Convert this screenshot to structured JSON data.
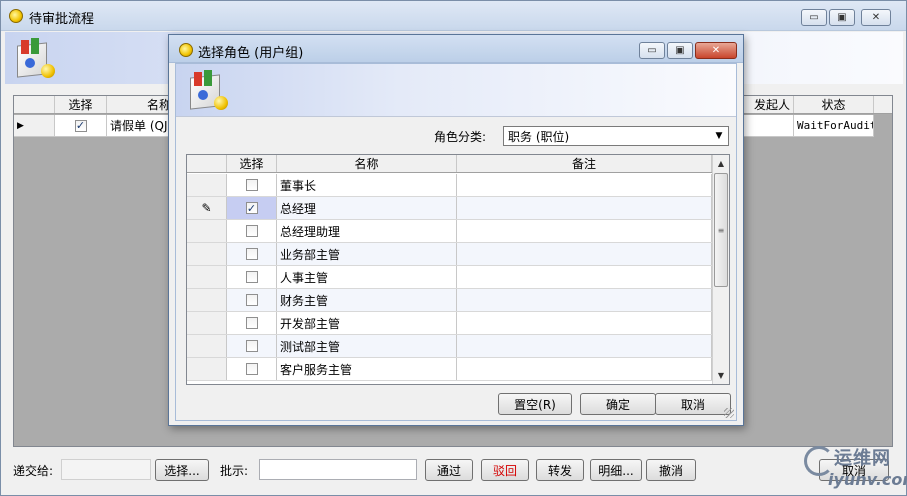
{
  "main_window": {
    "title": "待审批流程",
    "controls": {
      "minimize": "▭",
      "maximize": "▣",
      "close": "✕"
    }
  },
  "back_grid": {
    "headers": [
      "选择",
      "名称",
      "...",
      "发起人",
      "状态"
    ],
    "header_visible": {
      "select": "选择",
      "name": "名称",
      "initiator": "发起人",
      "status": "状态"
    },
    "row": {
      "indicator": "▶",
      "checked": true,
      "name": "请假单 (QJD-",
      "status": "WaitForAudit"
    }
  },
  "bottom_bar": {
    "submit_to_label": "递交给:",
    "submit_to_value": "",
    "select_button": "选择...",
    "comment_label": "批示:",
    "comment_value": "",
    "pass_button": "通过",
    "reject_button": "驳回",
    "forward_button": "转发",
    "detail_button": "明细...",
    "revoke_button": "撤消",
    "cancel_button": "取消"
  },
  "dialog": {
    "title": "选择角色 (用户组)",
    "controls": {
      "minimize": "▭",
      "maximize": "▣",
      "close": "✕"
    },
    "category_label": "角色分类:",
    "category_value": "职务 (职位)",
    "grid": {
      "headers": {
        "select": "选择",
        "name": "名称",
        "remark": "备注"
      },
      "rows": [
        {
          "name": "董事长",
          "checked": false,
          "remark": ""
        },
        {
          "name": "总经理",
          "checked": true,
          "remark": "",
          "editing": true
        },
        {
          "name": "总经理助理",
          "checked": false,
          "remark": ""
        },
        {
          "name": "业务部主管",
          "checked": false,
          "remark": ""
        },
        {
          "name": "人事主管",
          "checked": false,
          "remark": ""
        },
        {
          "name": "财务主管",
          "checked": false,
          "remark": ""
        },
        {
          "name": "开发部主管",
          "checked": false,
          "remark": ""
        },
        {
          "name": "测试部主管",
          "checked": false,
          "remark": ""
        },
        {
          "name": "客户服务主管",
          "checked": false,
          "remark": ""
        }
      ],
      "edit_indicator": "✎"
    },
    "clear_button": "置空(R)",
    "ok_button": "确定",
    "cancel_button": "取消"
  },
  "watermark": {
    "line1": "运维网",
    "line2": "iyunv.com"
  },
  "icons": {
    "title_icon": "sun-icon",
    "banner_icon": "app-install-icon",
    "dropdown": "chevron-down-icon"
  }
}
